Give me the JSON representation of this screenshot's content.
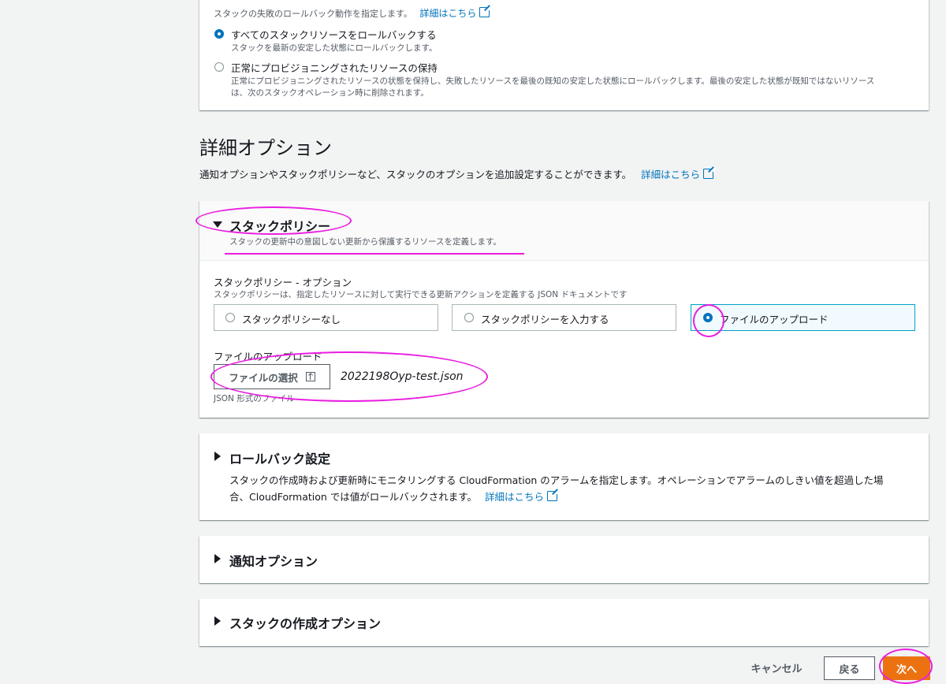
{
  "rollback_section": {
    "description": "スタックの失敗のロールバック動作を指定します。",
    "learn_more": "詳細はこちら",
    "options": [
      {
        "label": "すべてのスタックリソースをロールバックする",
        "description": "スタックを最新の安定した状態にロールバックします。",
        "selected": true
      },
      {
        "label": "正常にプロビジョニングされたリソースの保持",
        "description_line1": "正常にプロビジョニングされたリソースの状態を保持し、失敗したリソースを最後の既知の安定した状態にロールバックします。最後の安定した状態が既知ではないリソース",
        "description_line2": "は、次のスタックオペレーション時に削除されます。",
        "selected": false
      }
    ]
  },
  "advanced": {
    "title": "詳細オプション",
    "description": "通知オプションやスタックポリシーなど、スタックのオプションを追加設定することができます。",
    "learn_more": "詳細はこちら"
  },
  "stack_policy": {
    "title": "スタックポリシー",
    "description": "スタックの更新中の意図しない更新から保護するリソースを定義します。",
    "field_label": "スタックポリシー - オプション",
    "field_help": "スタックポリシーは、指定したリソースに対して実行できる更新アクションを定義する JSON ドキュメントです",
    "options": [
      {
        "label": "スタックポリシーなし",
        "selected": false
      },
      {
        "label": "スタックポリシーを入力する",
        "selected": false
      },
      {
        "label": "ファイルのアップロード",
        "selected": true
      }
    ],
    "upload_label": "ファイルのアップロード",
    "choose_file_button": "ファイルの選択",
    "file_name": "2022198Oyp-test.json",
    "file_help": "JSON 形式のファイル"
  },
  "rollback_config": {
    "title": "ロールバック設定",
    "description_line1": "スタックの作成時および更新時にモニタリングする CloudFormation のアラームを指定します。オペレーションでアラームのしきい値を超過した場",
    "description_line2": "合、CloudFormation では値がロールバックされます。",
    "learn_more": "詳細はこちら"
  },
  "notification": {
    "title": "通知オプション"
  },
  "creation_options": {
    "title": "スタックの作成オプション"
  },
  "footer": {
    "cancel": "キャンセル",
    "back": "戻る",
    "next": "次へ"
  },
  "colors": {
    "accent": "#0073bb",
    "primary_button": "#ec7211",
    "annotation": "#e91ee0"
  }
}
